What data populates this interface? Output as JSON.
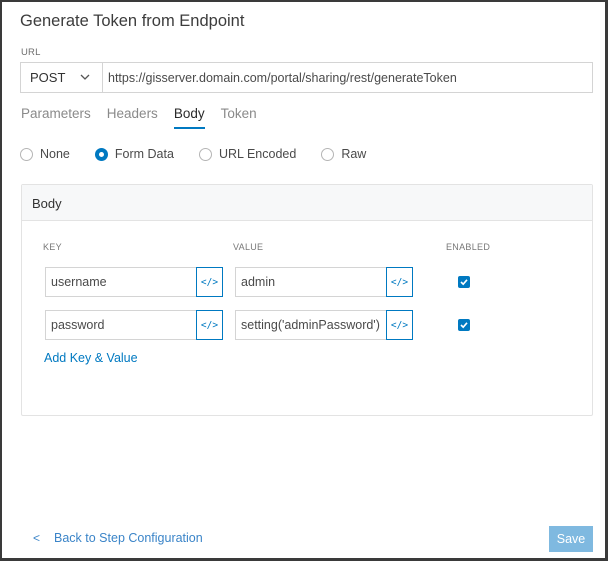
{
  "dialog": {
    "title": "Generate Token from Endpoint"
  },
  "url_section": {
    "label": "URL",
    "method": "POST",
    "url_value": "https://gisserver.domain.com/portal/sharing/rest/generateToken"
  },
  "tabs": [
    {
      "label": "Parameters",
      "active": false
    },
    {
      "label": "Headers",
      "active": false
    },
    {
      "label": "Body",
      "active": true
    },
    {
      "label": "Token",
      "active": false
    }
  ],
  "body_types": [
    {
      "label": "None",
      "checked": false
    },
    {
      "label": "Form Data",
      "checked": true
    },
    {
      "label": "URL Encoded",
      "checked": false
    },
    {
      "label": "Raw",
      "checked": false
    }
  ],
  "body_panel": {
    "title": "Body",
    "columns": {
      "key": "KEY",
      "value": "VALUE",
      "enabled": "ENABLED"
    },
    "rows": [
      {
        "key": "username",
        "value": "admin",
        "enabled": true,
        "code_icon": "</>"
      },
      {
        "key": "password",
        "value": "setting('adminPassword')",
        "enabled": true,
        "code_icon": "</>"
      }
    ],
    "add_link": "Add Key & Value"
  },
  "footer": {
    "back_arrow": "<",
    "back_label": "Back to Step Configuration",
    "save_label": "Save"
  },
  "colors": {
    "accent": "#0079c1",
    "save_disabled": "#7fb9e0"
  }
}
